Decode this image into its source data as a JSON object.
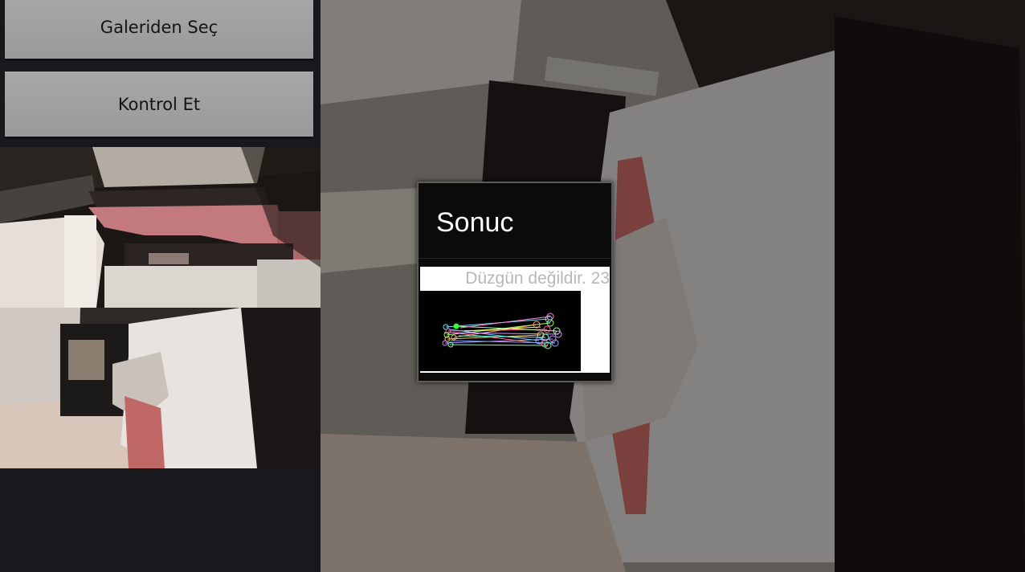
{
  "buttons": {
    "gallery_label": "Galeriden Seç",
    "check_label": "Kontrol Et"
  },
  "dialog": {
    "title": "Sonuc",
    "message": "Düzgün değildir.  23"
  },
  "images": {
    "thumbnail_1": "bedroom-photo-rotated",
    "thumbnail_2": "bed-photo-pixelated",
    "background": "bed-photo",
    "match_result": "feature-matches-image"
  },
  "colors": {
    "button_bg": "#a0a0a0",
    "left_panel_bg": "#17191d",
    "dialog_bg": "#0b0b0b",
    "message_color": "#b7b7b7"
  }
}
